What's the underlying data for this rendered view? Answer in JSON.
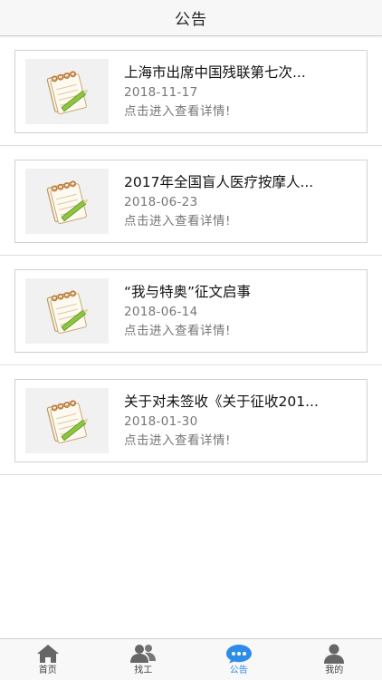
{
  "header": {
    "title": "公告"
  },
  "notices": [
    {
      "title": "上海市出席中国残联第七次...",
      "date": "2018-11-17",
      "hint": "点击进入查看详情!"
    },
    {
      "title": "2017年全国盲人医疗按摩人...",
      "date": "2018-06-23",
      "hint": "点击进入查看详情!"
    },
    {
      "title": "“我与特奥”征文启事",
      "date": "2018-06-14",
      "hint": "点击进入查看详情!"
    },
    {
      "title": "关于对未签收《关于征收201...",
      "date": "2018-01-30",
      "hint": "点击进入查看详情!"
    }
  ],
  "tabbar": {
    "items": [
      {
        "label": "首页",
        "icon": "home-icon"
      },
      {
        "label": "找工",
        "icon": "people-icon"
      },
      {
        "label": "公告",
        "icon": "chat-bubble-icon"
      },
      {
        "label": "我的",
        "icon": "user-icon"
      }
    ],
    "active_index": 2,
    "active_color": "#2f8be8",
    "inactive_color": "#666666"
  }
}
